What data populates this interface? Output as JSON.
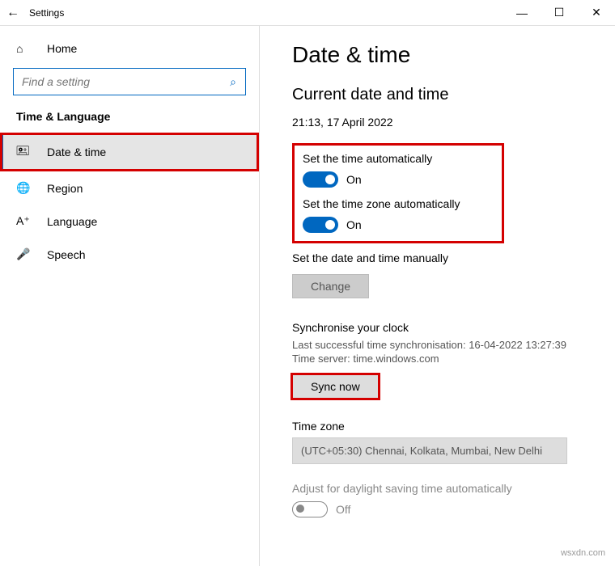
{
  "titlebar": {
    "title": "Settings"
  },
  "sidebar": {
    "home": "Home",
    "search_placeholder": "Find a setting",
    "section": "Time & Language",
    "items": [
      {
        "label": "Date & time"
      },
      {
        "label": "Region"
      },
      {
        "label": "Language"
      },
      {
        "label": "Speech"
      }
    ]
  },
  "main": {
    "heading": "Date & time",
    "subheading": "Current date and time",
    "current": "21:13, 17 April 2022",
    "auto_time": {
      "label": "Set the time automatically",
      "state": "On"
    },
    "auto_tz": {
      "label": "Set the time zone automatically",
      "state": "On"
    },
    "manual": {
      "label": "Set the date and time manually",
      "button": "Change"
    },
    "sync": {
      "heading": "Synchronise your clock",
      "last": "Last successful time synchronisation: 16-04-2022 13:27:39",
      "server": "Time server: time.windows.com",
      "button": "Sync now"
    },
    "tz": {
      "heading": "Time zone",
      "value": "(UTC+05:30) Chennai, Kolkata, Mumbai, New Delhi"
    },
    "dst": {
      "label": "Adjust for daylight saving time automatically",
      "state": "Off"
    }
  },
  "watermark": "wsxdn.com"
}
